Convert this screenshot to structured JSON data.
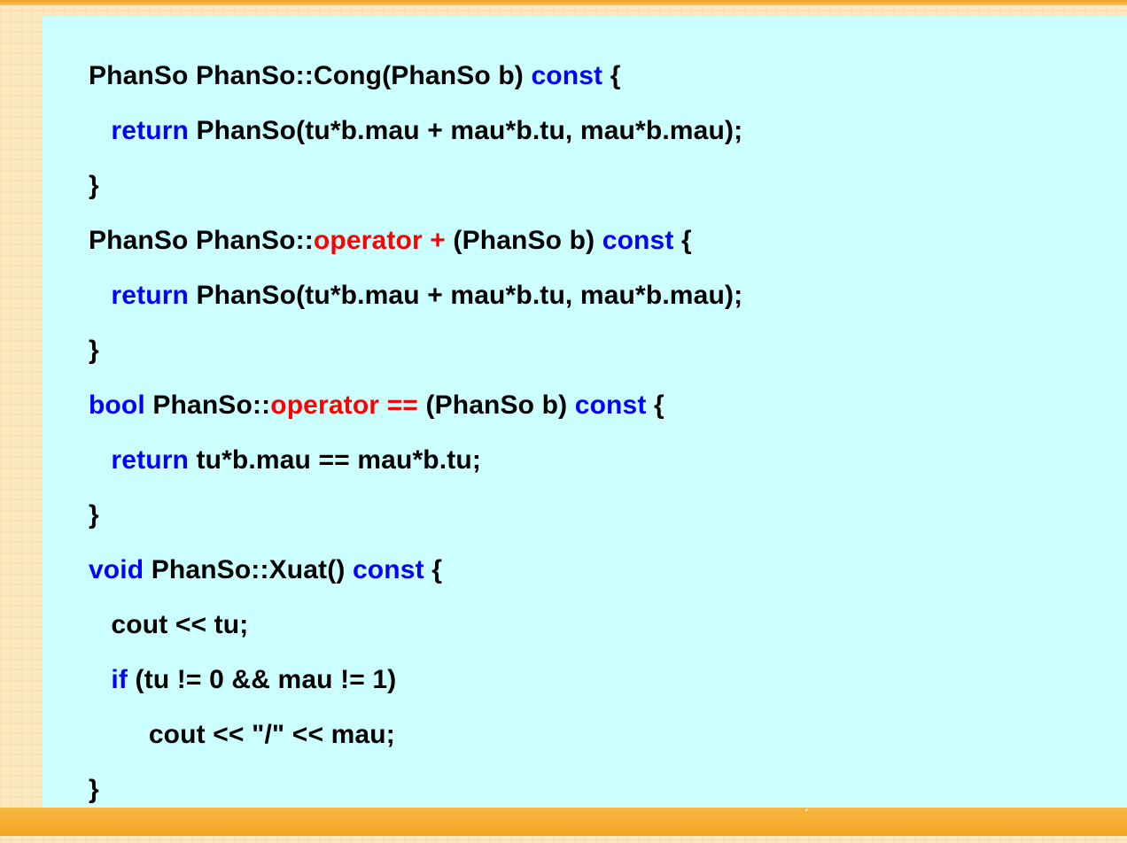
{
  "colors": {
    "normal": "#000000",
    "keyword": "#0000ff",
    "operator": "#ff0000",
    "code_background": "#ccffff",
    "slide_background": "#fbe7bd",
    "bar": "#f3a623"
  },
  "bottom_mark": "´",
  "code_lines": [
    {
      "tokens": [
        {
          "t": "PhanSo PhanSo::Cong(PhanSo b) ",
          "k": "normal"
        },
        {
          "t": "const",
          "k": "keyword"
        },
        {
          "t": " {",
          "k": "normal"
        }
      ]
    },
    {
      "tokens": [
        {
          "t": "   ",
          "k": "normal"
        },
        {
          "t": "return",
          "k": "keyword"
        },
        {
          "t": " PhanSo(tu*b.mau + mau*b.tu, mau*b.mau);",
          "k": "normal"
        }
      ]
    },
    {
      "tokens": [
        {
          "t": "}",
          "k": "normal"
        }
      ]
    },
    {
      "tokens": [
        {
          "t": "PhanSo PhanSo::",
          "k": "normal"
        },
        {
          "t": "operator +",
          "k": "operator"
        },
        {
          "t": " (PhanSo b) ",
          "k": "normal"
        },
        {
          "t": "const",
          "k": "keyword"
        },
        {
          "t": " {",
          "k": "normal"
        }
      ]
    },
    {
      "tokens": [
        {
          "t": "   ",
          "k": "normal"
        },
        {
          "t": "return",
          "k": "keyword"
        },
        {
          "t": " PhanSo(tu*b.mau + mau*b.tu, mau*b.mau);",
          "k": "normal"
        }
      ]
    },
    {
      "tokens": [
        {
          "t": "}",
          "k": "normal"
        }
      ]
    },
    {
      "tokens": [
        {
          "t": "bool",
          "k": "keyword"
        },
        {
          "t": " PhanSo::",
          "k": "normal"
        },
        {
          "t": "operator ==",
          "k": "operator"
        },
        {
          "t": " (PhanSo b) ",
          "k": "normal"
        },
        {
          "t": "const",
          "k": "keyword"
        },
        {
          "t": " {",
          "k": "normal"
        }
      ]
    },
    {
      "tokens": [
        {
          "t": "   ",
          "k": "normal"
        },
        {
          "t": "return",
          "k": "keyword"
        },
        {
          "t": " tu*b.mau == mau*b.tu;",
          "k": "normal"
        }
      ]
    },
    {
      "tokens": [
        {
          "t": "}",
          "k": "normal"
        }
      ]
    },
    {
      "tokens": [
        {
          "t": "void",
          "k": "keyword"
        },
        {
          "t": " PhanSo::Xuat() ",
          "k": "normal"
        },
        {
          "t": "const",
          "k": "keyword"
        },
        {
          "t": " {",
          "k": "normal"
        }
      ]
    },
    {
      "tokens": [
        {
          "t": "   cout << tu;",
          "k": "normal"
        }
      ]
    },
    {
      "tokens": [
        {
          "t": "   ",
          "k": "normal"
        },
        {
          "t": "if",
          "k": "keyword"
        },
        {
          "t": " (tu != 0 && mau != 1)",
          "k": "normal"
        }
      ]
    },
    {
      "tokens": [
        {
          "t": "        cout << \"/\" << mau;",
          "k": "normal"
        }
      ]
    },
    {
      "tokens": [
        {
          "t": "}",
          "k": "normal"
        }
      ]
    }
  ]
}
